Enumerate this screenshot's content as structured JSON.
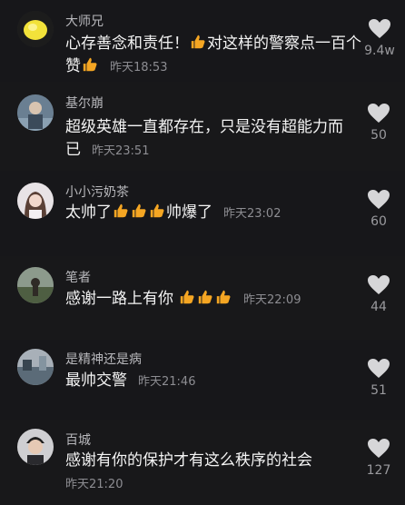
{
  "comments": [
    {
      "username": "大师兄",
      "text_before": "心存善念和责任！",
      "text_after": "对这样的警察点一百个赞",
      "thumbs_inline": 1,
      "thumbs_end": 1,
      "time": "昨天18:53",
      "likes": "9.4w",
      "avatar_icon": "lemon-avatar"
    },
    {
      "username": "基尔崩",
      "text": "超级英雄一直都存在，只是没有超能力而已",
      "time": "昨天23:51",
      "likes": "50",
      "avatar_icon": "person-avatar"
    },
    {
      "username": "小小污奶茶",
      "text_before": "太帅了",
      "text_after": "帅爆了",
      "thumbs_inline": 3,
      "time": "昨天23:02",
      "likes": "60",
      "avatar_icon": "girl-avatar"
    },
    {
      "username": "笔者",
      "text": "感谢一路上有你",
      "thumbs_end": 3,
      "time": "昨天22:09",
      "likes": "44",
      "avatar_icon": "landscape-avatar"
    },
    {
      "username": "是精神还是病",
      "text": "最帅交警",
      "time": "昨天21:46",
      "likes": "51",
      "avatar_icon": "scene-avatar"
    },
    {
      "username": "百城",
      "text": "感谢有你的保护才有这么秩序的社会",
      "time": "昨天21:20",
      "likes": "127",
      "avatar_icon": "man-avatar"
    }
  ],
  "colors": {
    "background": "#161618",
    "thumb": "#f5a623",
    "heart": "#d6d6d8"
  }
}
